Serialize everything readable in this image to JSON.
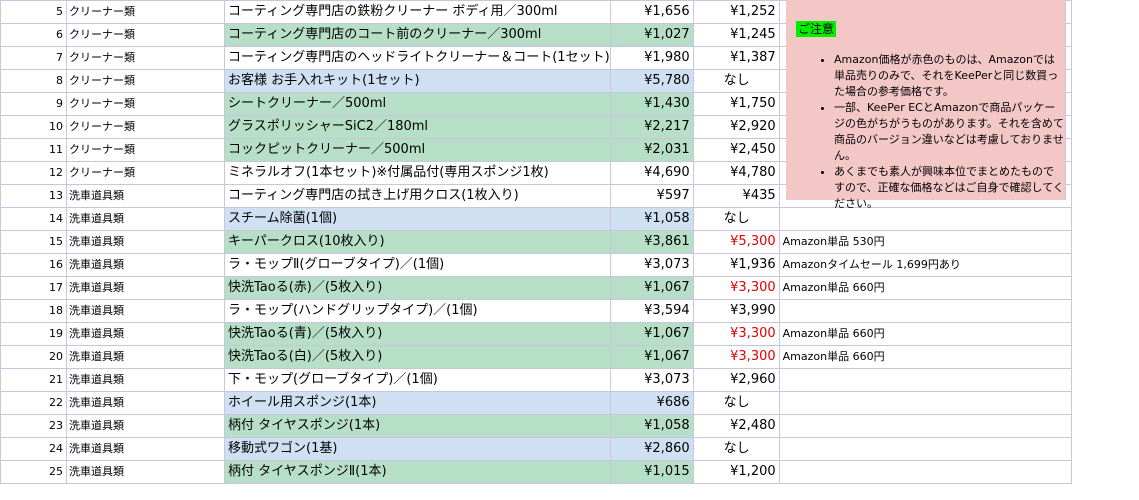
{
  "rows": [
    {
      "num": "5",
      "cat": "クリーナー類",
      "name": "コーティング専門店の鉄粉クリーナー ボディ用／300ml",
      "keeper": "¥1,656",
      "amazon": "¥1,252",
      "note": "",
      "hl": "none",
      "red": false
    },
    {
      "num": "6",
      "cat": "クリーナー類",
      "name": "コーティング専門店のコート前のクリーナー／300ml",
      "keeper": "¥1,027",
      "amazon": "¥1,245",
      "note": "",
      "hl": "green",
      "red": false
    },
    {
      "num": "7",
      "cat": "クリーナー類",
      "name": "コーティング専門店のヘッドライトクリーナー＆コート(1セット)",
      "keeper": "¥1,980",
      "amazon": "¥1,387",
      "note": "",
      "hl": "none",
      "red": false
    },
    {
      "num": "8",
      "cat": "クリーナー類",
      "name": "お客様 お手入れキット(1セット)",
      "keeper": "¥5,780",
      "amazon": "なし",
      "note": "",
      "hl": "blue",
      "red": false
    },
    {
      "num": "9",
      "cat": "クリーナー類",
      "name": "シートクリーナー／500ml",
      "keeper": "¥1,430",
      "amazon": "¥1,750",
      "note": "",
      "hl": "green",
      "red": false
    },
    {
      "num": "10",
      "cat": "クリーナー類",
      "name": "グラスポリッシャーSiC2／180ml",
      "keeper": "¥2,217",
      "amazon": "¥2,920",
      "note": "",
      "hl": "green",
      "red": false
    },
    {
      "num": "11",
      "cat": "クリーナー類",
      "name": "コックピットクリーナー／500ml",
      "keeper": "¥2,031",
      "amazon": "¥2,450",
      "note": "",
      "hl": "green",
      "red": false
    },
    {
      "num": "12",
      "cat": "クリーナー類",
      "name": "ミネラルオフ(1本セット)※付属品付(専用スポンジ1枚)",
      "keeper": "¥4,690",
      "amazon": "¥4,780",
      "note": "",
      "hl": "none",
      "red": false
    },
    {
      "num": "13",
      "cat": "洗車道具類",
      "name": "コーティング専門店の拭き上げ用クロス(1枚入り)",
      "keeper": "¥597",
      "amazon": "¥435",
      "note": "",
      "hl": "none",
      "red": false
    },
    {
      "num": "14",
      "cat": "洗車道具類",
      "name": "スチーム除菌(1個)",
      "keeper": "¥1,058",
      "amazon": "なし",
      "note": "",
      "hl": "blue",
      "red": false
    },
    {
      "num": "15",
      "cat": "洗車道具類",
      "name": "キーパークロス(10枚入り)",
      "keeper": "¥3,861",
      "amazon": "¥5,300",
      "note": "Amazon単品 530円",
      "hl": "green",
      "red": true
    },
    {
      "num": "16",
      "cat": "洗車道具類",
      "name": "ラ・モップⅡ(グローブタイプ)／(1個)",
      "keeper": "¥3,073",
      "amazon": "¥1,936",
      "note": "Amazonタイムセール 1,699円あり",
      "hl": "none",
      "red": false
    },
    {
      "num": "17",
      "cat": "洗車道具類",
      "name": "快洗Taoる(赤)／(5枚入り)",
      "keeper": "¥1,067",
      "amazon": "¥3,300",
      "note": "Amazon単品 660円",
      "hl": "green",
      "red": true
    },
    {
      "num": "18",
      "cat": "洗車道具類",
      "name": "ラ・モップ(ハンドグリップタイプ)／(1個)",
      "keeper": "¥3,594",
      "amazon": "¥3,990",
      "note": "",
      "hl": "none",
      "red": false
    },
    {
      "num": "19",
      "cat": "洗車道具類",
      "name": "快洗Taoる(青)／(5枚入り)",
      "keeper": "¥1,067",
      "amazon": "¥3,300",
      "note": "Amazon単品 660円",
      "hl": "green",
      "red": true
    },
    {
      "num": "20",
      "cat": "洗車道具類",
      "name": "快洗Taoる(白)／(5枚入り)",
      "keeper": "¥1,067",
      "amazon": "¥3,300",
      "note": "Amazon単品 660円",
      "hl": "green",
      "red": true
    },
    {
      "num": "21",
      "cat": "洗車道具類",
      "name": "下・モップ(グローブタイプ)／(1個)",
      "keeper": "¥3,073",
      "amazon": "¥2,960",
      "note": "",
      "hl": "none",
      "red": false
    },
    {
      "num": "22",
      "cat": "洗車道具類",
      "name": "ホイール用スポンジ(1本)",
      "keeper": "¥686",
      "amazon": "なし",
      "note": "",
      "hl": "blue",
      "red": false
    },
    {
      "num": "23",
      "cat": "洗車道具類",
      "name": "柄付 タイヤスポンジ(1本)",
      "keeper": "¥1,058",
      "amazon": "¥2,480",
      "note": "",
      "hl": "green",
      "red": false
    },
    {
      "num": "24",
      "cat": "洗車道具類",
      "name": "移動式ワゴン(1基)",
      "keeper": "¥2,860",
      "amazon": "なし",
      "note": "",
      "hl": "blue",
      "red": false
    },
    {
      "num": "25",
      "cat": "洗車道具類",
      "name": "柄付 タイヤスポンジⅡ(1本)",
      "keeper": "¥1,015",
      "amazon": "¥1,200",
      "note": "",
      "hl": "green",
      "red": false
    }
  ],
  "notice": {
    "title": "ご注意",
    "items": [
      "Amazon価格が赤色のものは、Amazonでは単品売りのみで、それをKeePerと同じ数買った場合の参考価格です。",
      "一部、KeePer ECとAmazonで商品パッケージの色がちがうものがあります。それを含めて商品のバージョン違いなどは考慮しておりません。",
      "あくまでも素人が興味本位でまとめたものですので、正確な価格などはご自身で確認してください。"
    ]
  },
  "colors": {
    "green": "#b7dfc7",
    "blue": "#cfe0f3",
    "notice_bg": "#f4c7c7",
    "title_bg": "#00ee00",
    "red": "#e00000"
  }
}
